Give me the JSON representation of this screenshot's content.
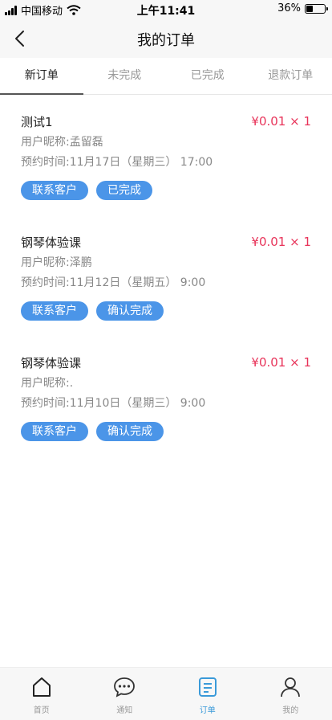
{
  "status_bar": {
    "carrier": "中国移动",
    "time": "上午11:41",
    "battery_percent": "36%",
    "battery_level": 0.36
  },
  "nav": {
    "title": "我的订单"
  },
  "tabs": [
    {
      "label": "新订单",
      "active": true
    },
    {
      "label": "未完成",
      "active": false
    },
    {
      "label": "已完成",
      "active": false
    },
    {
      "label": "退款订单",
      "active": false
    }
  ],
  "orders": [
    {
      "title": "测试1",
      "price": "¥0.01 × 1",
      "nickname": "用户昵称:孟留磊",
      "time": "预约时间:11月17日（星期三） 17:00",
      "contact_label": "联系客户",
      "status_label": "已完成"
    },
    {
      "title": "钢琴体验课",
      "price": "¥0.01 × 1",
      "nickname": "用户昵称:泽鹏",
      "time": "预约时间:11月12日（星期五） 9:00",
      "contact_label": "联系客户",
      "status_label": "确认完成"
    },
    {
      "title": "钢琴体验课",
      "price": "¥0.01 × 1",
      "nickname": "用户昵称:.",
      "time": "预约时间:11月10日（星期三） 9:00",
      "contact_label": "联系客户",
      "status_label": "确认完成"
    }
  ],
  "tab_bar": [
    {
      "label": "首页",
      "icon": "home-icon",
      "active": false
    },
    {
      "label": "通知",
      "icon": "chat-bubble-icon",
      "active": false
    },
    {
      "label": "订单",
      "icon": "order-document-icon",
      "active": true
    },
    {
      "label": "我的",
      "icon": "person-icon",
      "active": false
    }
  ],
  "colors": {
    "accent": "#4b95e8",
    "price": "#e8345a",
    "active_tab": "#3a9ad9"
  }
}
